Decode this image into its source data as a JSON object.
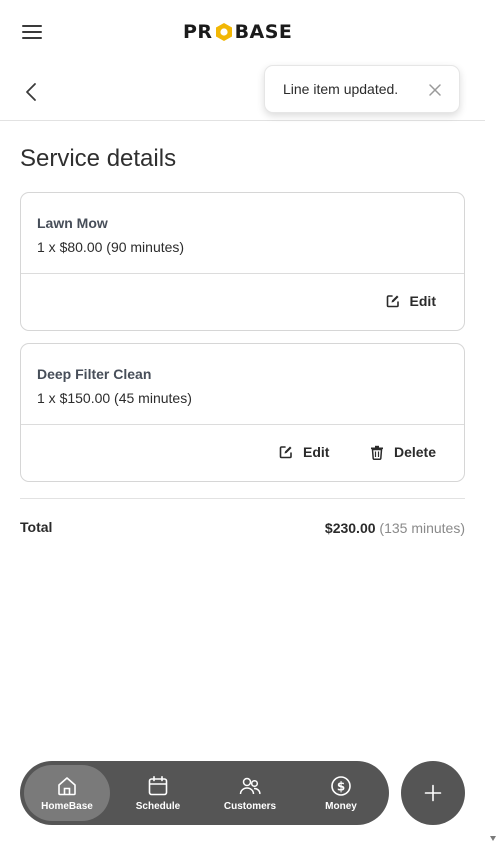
{
  "app": {
    "logo_text": "PROBASE",
    "brand_color": "#F2B705"
  },
  "header": {
    "menu_icon": "hamburger-icon",
    "back_icon": "chevron-left-icon"
  },
  "toast": {
    "message": "Line item updated.",
    "close_icon": "close-icon"
  },
  "page": {
    "title": "Service details"
  },
  "line_items": [
    {
      "name": "Lawn Mow",
      "quantity_line": "1 x $80.00 (90 minutes)",
      "actions": {
        "edit": "Edit"
      }
    },
    {
      "name": "Deep Filter Clean",
      "quantity_line": "1 x $150.00 (45 minutes)",
      "actions": {
        "edit": "Edit",
        "delete": "Delete"
      }
    }
  ],
  "summary": {
    "label": "Total",
    "amount": "$230.00",
    "minutes": "(135 minutes)"
  },
  "nav": {
    "items": [
      {
        "label": "HomeBase",
        "icon": "home-icon",
        "active": true
      },
      {
        "label": "Schedule",
        "icon": "calendar-icon",
        "active": false
      },
      {
        "label": "Customers",
        "icon": "users-icon",
        "active": false
      },
      {
        "label": "Money",
        "icon": "dollar-circle-icon",
        "active": false
      }
    ],
    "fab_icon": "plus-icon"
  }
}
